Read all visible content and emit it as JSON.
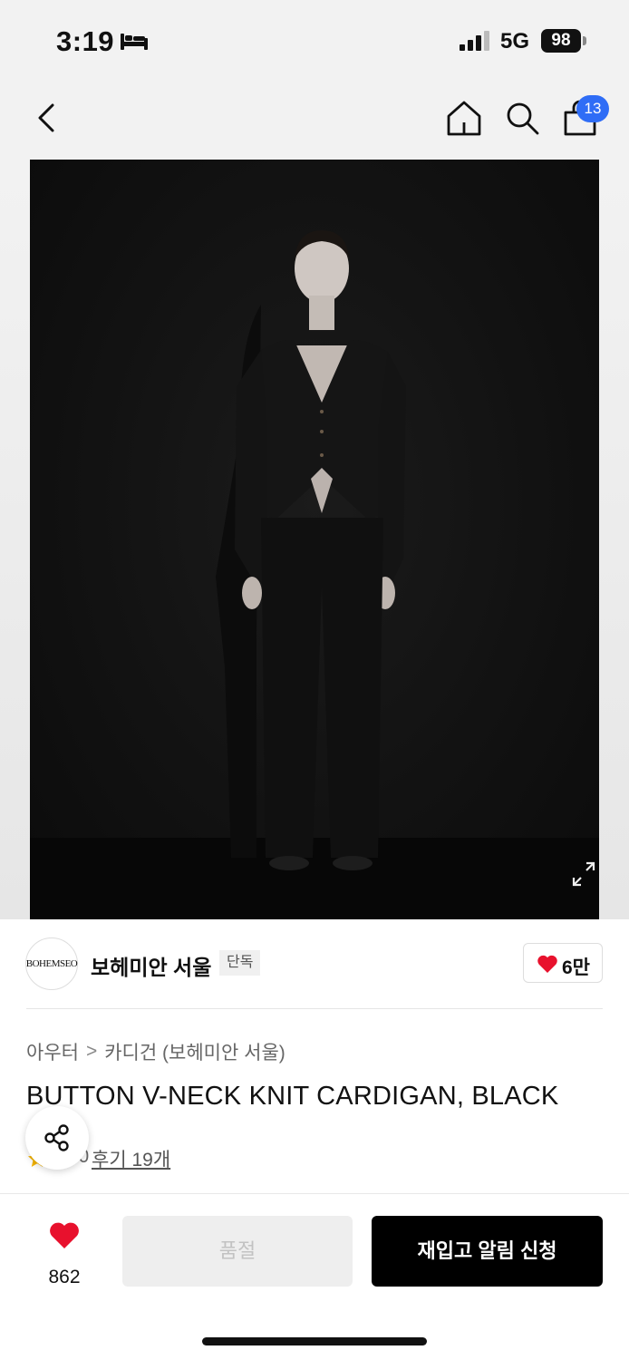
{
  "status_bar": {
    "time": "3:19",
    "network": "5G",
    "battery": "98"
  },
  "nav": {
    "cart_count": "13"
  },
  "brand": {
    "logo_text": "BOHEMSEO",
    "name": "보헤미안 서울",
    "exclusive_label": "단독",
    "likes": "6만"
  },
  "breadcrumb": {
    "category": "아우터",
    "separator": ">",
    "subcategory": "카디건 (보헤미안 서울)"
  },
  "product": {
    "title": "BUTTON V-NECK KNIT CARDIGAN, BLACK",
    "rating": "5.0",
    "review_label": "후기 19개"
  },
  "actions": {
    "wish_count": "862",
    "soldout_label": "품절",
    "restock_label": "재입고 알림 신청"
  },
  "colors": {
    "accent_blue": "#2f6df6",
    "heart_red": "#e8112d",
    "primary_black": "#000000"
  }
}
